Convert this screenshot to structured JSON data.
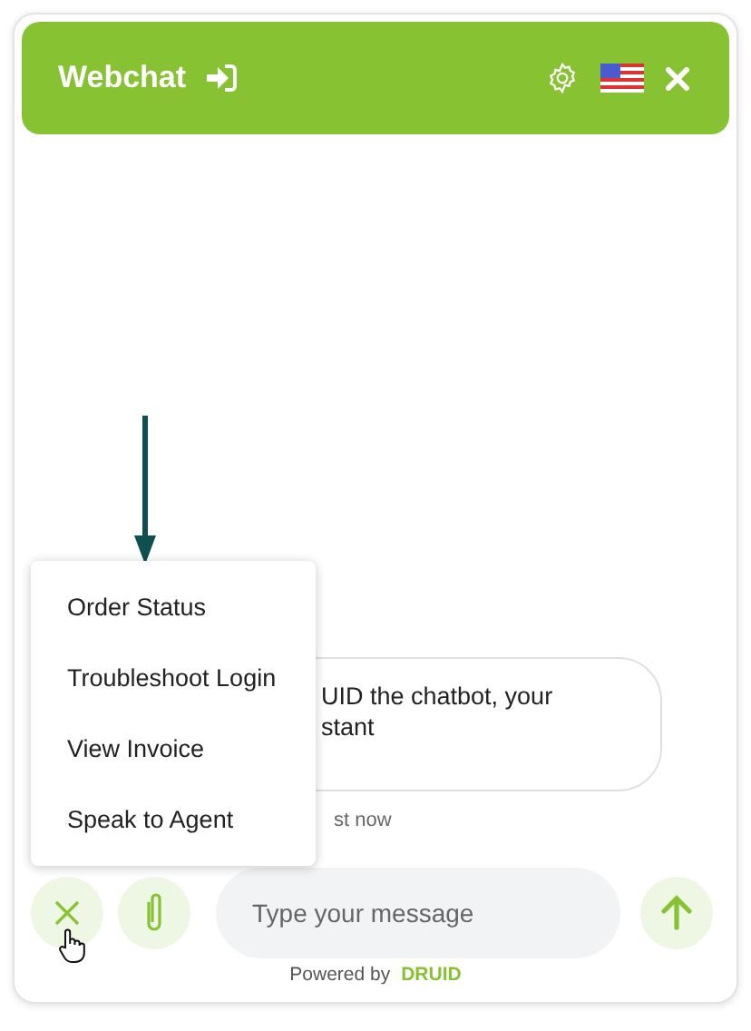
{
  "header": {
    "title": "Webchat"
  },
  "menu": {
    "items": [
      "Order Status",
      "Troubleshoot Login",
      "View Invoice",
      "Speak to Agent"
    ]
  },
  "messages": [
    {
      "lines": [
        "UID the chatbot, your",
        "stant"
      ],
      "time": "st now"
    }
  ],
  "composer": {
    "placeholder": "Type your message"
  },
  "footer": {
    "label": "Powered by",
    "brand": "DRUID"
  }
}
